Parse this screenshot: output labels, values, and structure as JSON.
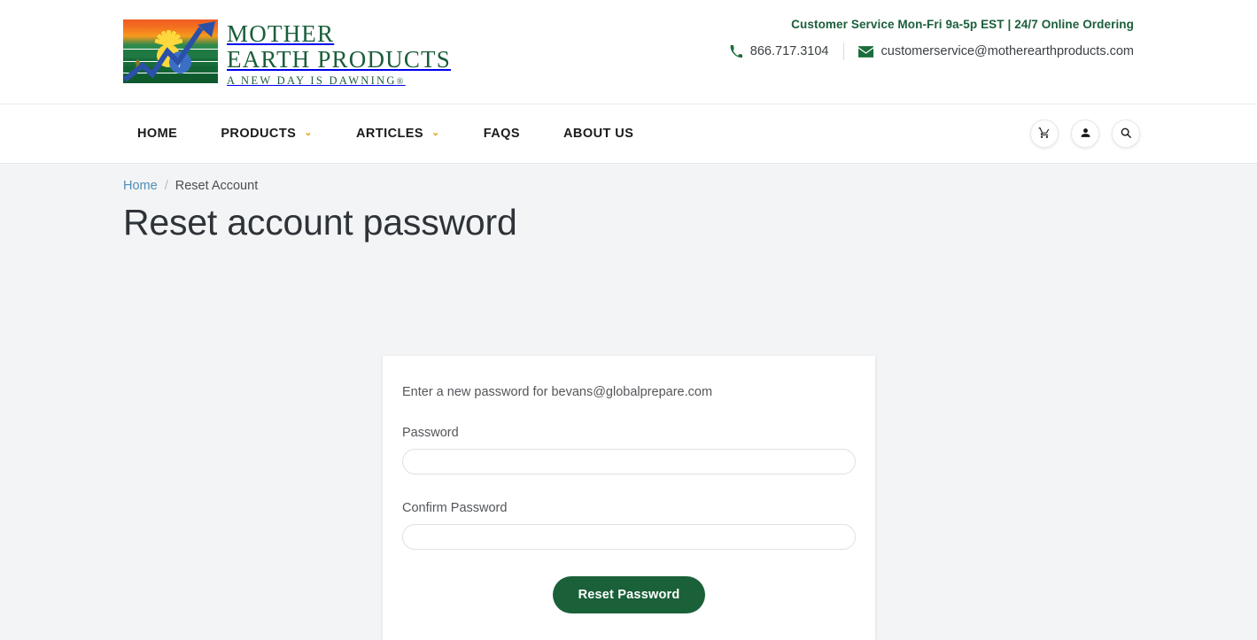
{
  "header": {
    "logo": {
      "line1": "MOTHER",
      "line2": "EARTH PRODUCTS",
      "tagline": "A NEW DAY IS DAWNING",
      "registered_mark": "®",
      "alt": "Mother Earth Products - A New Day Is Dawning",
      "brand_green": "#1b5e3a"
    },
    "contact": {
      "hours": "Customer Service Mon-Fri 9a-5p EST | 24/7 Online Ordering",
      "phone": "866.717.3104",
      "phone_icon": "phone-icon",
      "email": "customerservice@motherearthproducts.com",
      "email_icon": "envelope-icon"
    }
  },
  "nav": {
    "items": [
      {
        "label": "HOME",
        "has_dropdown": false
      },
      {
        "label": "PRODUCTS",
        "has_dropdown": true,
        "caret": "⌄"
      },
      {
        "label": "ARTICLES",
        "has_dropdown": true,
        "caret": "⌄"
      },
      {
        "label": "FAQS",
        "has_dropdown": false
      },
      {
        "label": "ABOUT US",
        "has_dropdown": false
      }
    ],
    "caret_color": "#e0a71c",
    "icons": [
      {
        "name": "cart-icon",
        "title": "Shopping Cart"
      },
      {
        "name": "user-icon",
        "title": "My Account"
      },
      {
        "name": "search-icon",
        "title": "Search"
      }
    ]
  },
  "breadcrumb": {
    "home": "Home",
    "separator": "/",
    "current": "Reset Account"
  },
  "main": {
    "title": "Reset account password",
    "card": {
      "intro": "Enter a new password for bevans@globalprepare.com",
      "fields": [
        {
          "label": "Password",
          "value": "",
          "placeholder": "",
          "type": "password",
          "name": "password-input"
        },
        {
          "label": "Confirm Password",
          "value": "",
          "placeholder": "",
          "type": "password",
          "name": "confirm-password-input"
        }
      ],
      "submit_label": "Reset Password",
      "submit_color": "#1a6038"
    }
  },
  "colors": {
    "page_background": "#f3f4f6",
    "card_background": "#ffffff",
    "brand_green": "#1b5e3a",
    "accent_gold": "#e0a71c",
    "link_blue": "#4f8fb5"
  }
}
